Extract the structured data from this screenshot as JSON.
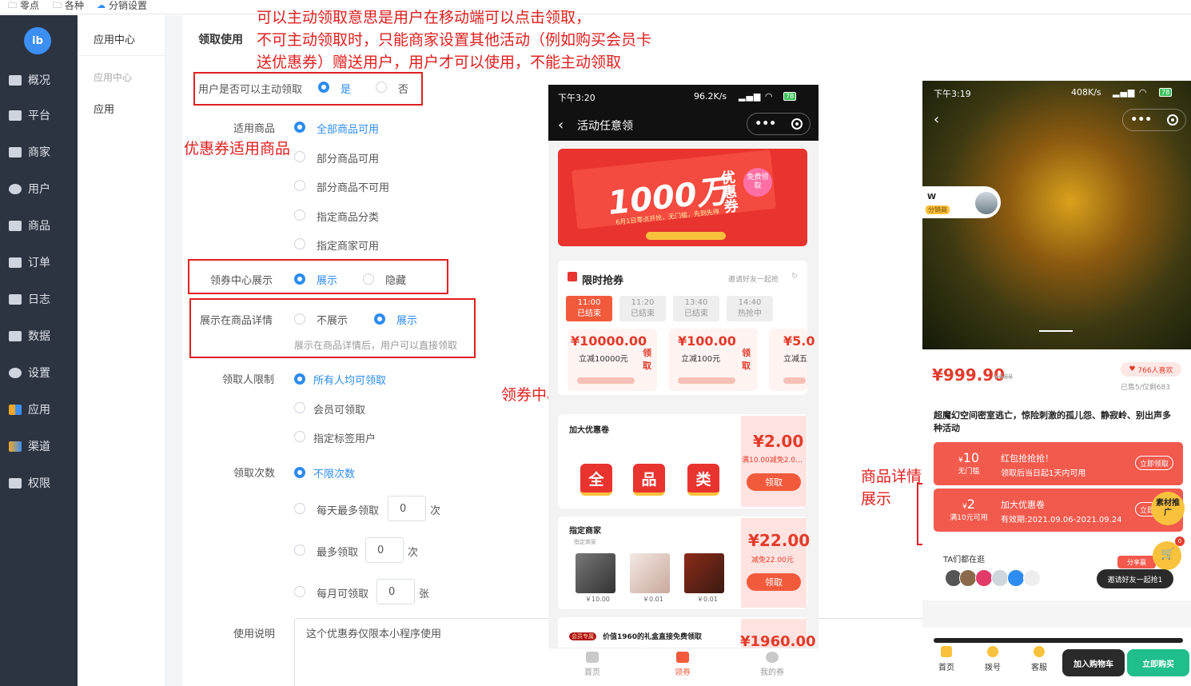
{
  "bookmarks": [
    {
      "label": "零点",
      "icon": "folder-icon"
    },
    {
      "label": "各种",
      "icon": "folder-icon"
    },
    {
      "label": "分销设置",
      "icon": "cloud-icon"
    }
  ],
  "sidebar": {
    "items": [
      {
        "label": "概况",
        "icon": "overview-icon"
      },
      {
        "label": "平台",
        "icon": "platform-icon"
      },
      {
        "label": "商家",
        "icon": "shop-icon"
      },
      {
        "label": "用户",
        "icon": "user-icon"
      },
      {
        "label": "商品",
        "icon": "goods-icon"
      },
      {
        "label": "订单",
        "icon": "order-icon"
      },
      {
        "label": "日志",
        "icon": "log-icon"
      },
      {
        "label": "数据",
        "icon": "chart-icon"
      },
      {
        "label": "设置",
        "icon": "settings-icon"
      },
      {
        "label": "应用",
        "icon": "apps-icon"
      },
      {
        "label": "渠道",
        "icon": "channel-icon"
      },
      {
        "label": "权限",
        "icon": "lock-icon"
      }
    ]
  },
  "subnav": {
    "title": "应用中心",
    "group": "应用中心",
    "item": "应用"
  },
  "form": {
    "section": "领取使用",
    "active_claim": {
      "label": "用户是否可以主动领取",
      "yes": "是",
      "no": "否",
      "selected": "是"
    },
    "applicable": {
      "label": "适用商品",
      "options": [
        "全部商品可用",
        "部分商品可用",
        "部分商品不可用",
        "指定商品分类",
        "指定商家可用"
      ],
      "selected": "全部商品可用"
    },
    "coupon_center": {
      "label": "领券中心展示",
      "show": "展示",
      "hide": "隐藏",
      "selected": "展示"
    },
    "detail_display": {
      "label": "展示在商品详情",
      "no": "不展示",
      "yes": "展示",
      "selected": "展示",
      "hint": "展示在商品详情后，用户可以直接领取"
    },
    "claimers": {
      "label": "领取人限制",
      "options": [
        "所有人均可领取",
        "会员可领取",
        "指定标签用户"
      ],
      "selected": "所有人均可领取"
    },
    "times": {
      "label": "领取次数",
      "unlimited": "不限次数",
      "daily": {
        "label": "每天最多领取",
        "value": "0",
        "unit": "次"
      },
      "max": {
        "label": "最多领取",
        "value": "0",
        "unit": "次"
      },
      "monthly": {
        "label": "每月可领取",
        "value": "0",
        "unit": "张"
      }
    },
    "usage": {
      "label": "使用说明",
      "value": "这个优惠券仅限本小程序使用"
    }
  },
  "annotations": {
    "top": [
      "可以主动领取意思是用户在移动端可以点击领取，",
      "不可主动领取时，只能商家设置其他活动（例如购买会员卡",
      "送优惠券）赠送用户，用户才可以使用，不能主动领取"
    ],
    "goods": "优惠券适用商品",
    "center": "领券中心展示",
    "detail": [
      "商品详情",
      "展示"
    ]
  },
  "phone1": {
    "status": {
      "time": "下午3:20",
      "speed": "96.2K/s",
      "battery": "78"
    },
    "title": "活动任意领",
    "banner": {
      "big": "1000万",
      "small": "优惠券",
      "badge": "免费领取",
      "sub": "6月1日零点开抢，无门槛，先到先得"
    },
    "flash": {
      "title": "限时抢券",
      "invite": "邀请好友一起抢",
      "slots": [
        {
          "time": "11:00",
          "state": "已结束"
        },
        {
          "time": "11:20",
          "state": "已结束"
        },
        {
          "time": "13:40",
          "state": "已结束"
        },
        {
          "time": "14:40",
          "state": "热抢中"
        }
      ],
      "coupons": [
        {
          "price": "10000.00",
          "desc": "立减10000元",
          "grab": "领取"
        },
        {
          "price": "100.00",
          "desc": "立减100元",
          "grab": "领取"
        },
        {
          "price": "5.0",
          "desc": "立减五"
        }
      ]
    },
    "card1": {
      "title": "加大优惠卷",
      "tags": [
        "全",
        "品",
        "类"
      ],
      "price": "2.00",
      "desc": "满10.00减免2.0…",
      "btn": "领取"
    },
    "card2": {
      "title": "指定商家",
      "sub": "指定商家",
      "thumbs": [
        "￥10.00",
        "￥0.01",
        "￥0.01"
      ],
      "price": "22.00",
      "desc": "减免22.00元",
      "btn": "领取"
    },
    "card3": {
      "badge": "会员专属",
      "title": "价值1960的礼盒直接免费领取",
      "price": "1960.00"
    },
    "tabs": [
      "首页",
      "领券",
      "我的券"
    ],
    "active_tab": "领券"
  },
  "phone2": {
    "status": {
      "time": "下午3:19",
      "speed": "408K/s",
      "battery": "78"
    },
    "sharer": {
      "name": "W",
      "badge": "分销商"
    },
    "price": "999.90",
    "orig_price": "688",
    "likes": "766人喜欢",
    "sold": "已售5/仅剩683",
    "title": "超魔幻空间密室逃亡，惊险刺激的孤儿怨、静寂岭、别出声多种活动",
    "coupons": [
      {
        "amount": "10",
        "cond": "无门槛",
        "t1": "红包抢抢抢！",
        "t2": "领取后当日起1天内可用",
        "btn": "立即领取"
      },
      {
        "amount": "2",
        "cond": "满10元可用",
        "t1": "加大优惠卷",
        "t2": "有效期:2021.09.06-2021.09.24",
        "btn": "立即领取"
      }
    ],
    "promo": "素材推广",
    "share_label": "分享赢",
    "visitors": "TA们都在逛",
    "invite_btn": "邀请好友一起抢1",
    "tabs": [
      "首页",
      "拨号",
      "客服"
    ],
    "cart_btn": "加入购物车",
    "buy_btn": "立即购买",
    "cart_badge": "0"
  },
  "colors": {
    "accent": "#2d8cf0",
    "annotation": "#e02020",
    "sidebar": "#2c3442",
    "coupon_red": "#f25a4d",
    "buy_green": "#1fbe8c"
  }
}
